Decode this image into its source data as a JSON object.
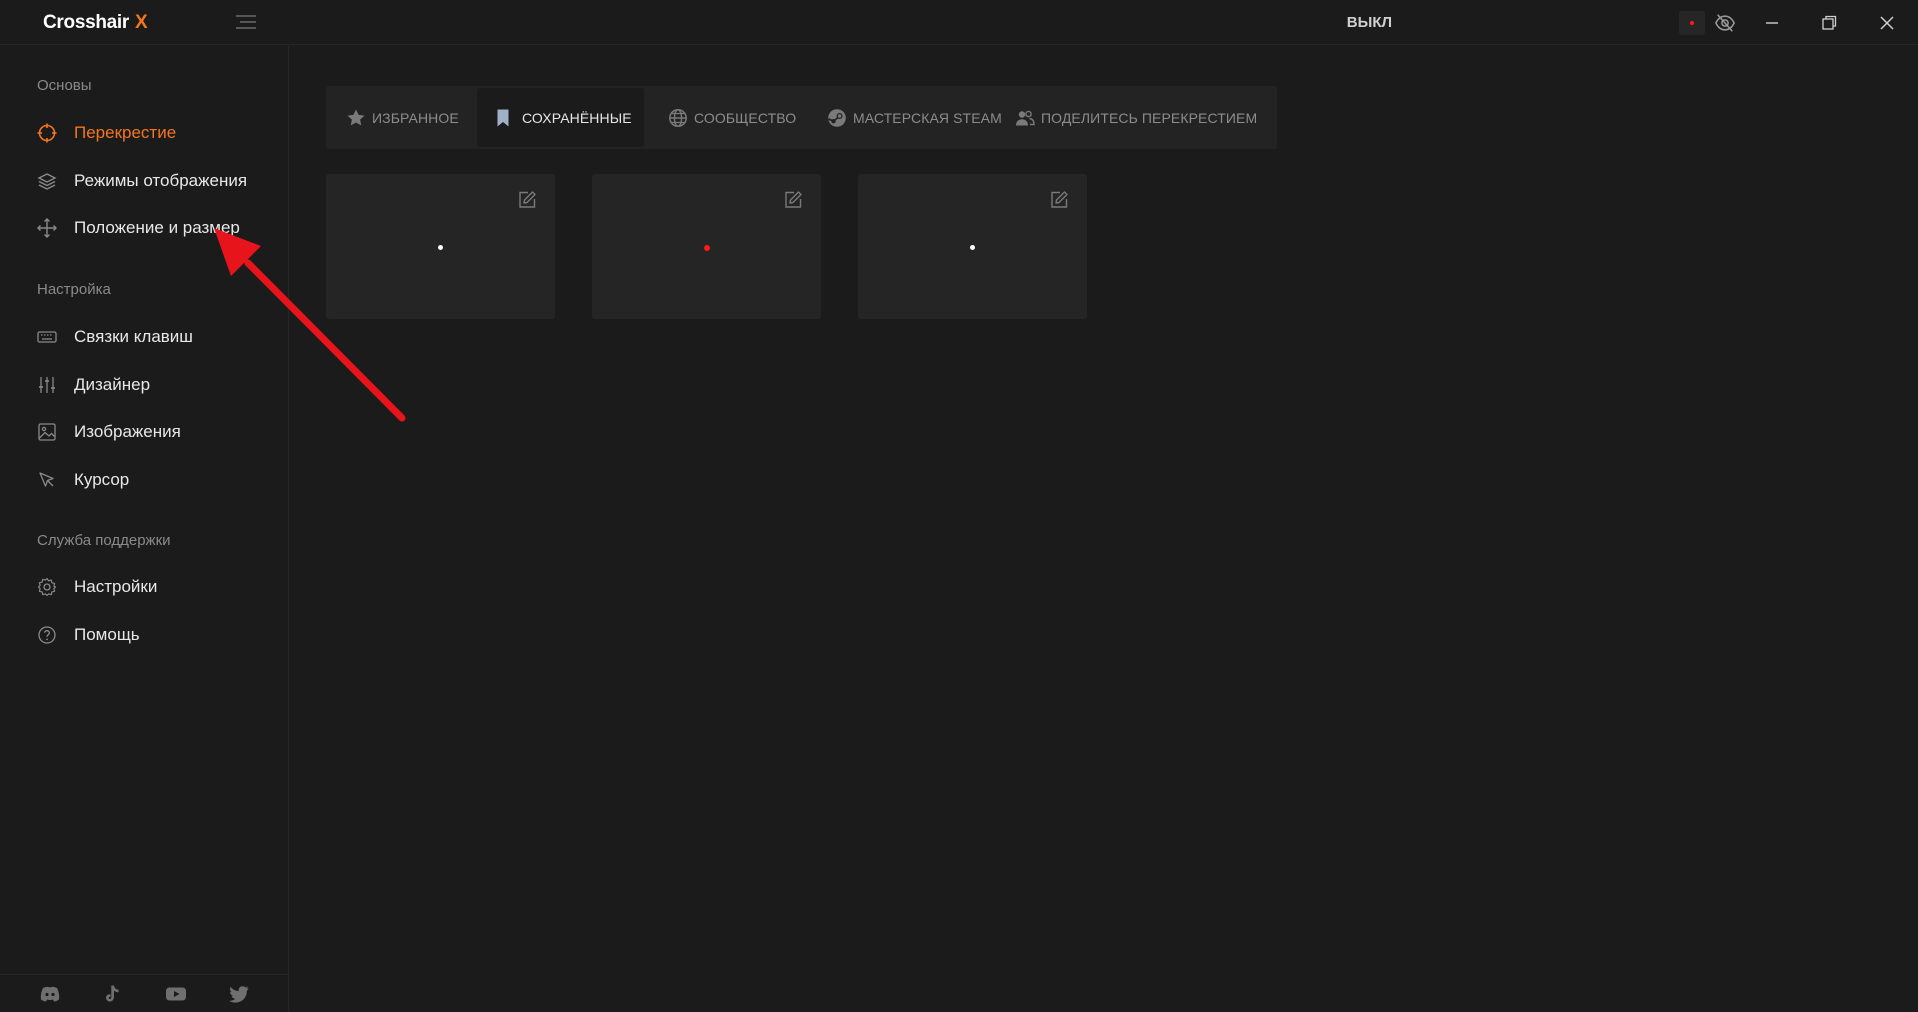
{
  "app": {
    "name": "Crosshair",
    "name_suffix": "X",
    "status_label": "ВЫКЛ"
  },
  "colors": {
    "accent": "#f5751f",
    "background": "#1b1b1b",
    "card": "#252525",
    "dot_red": "#ff1a1a",
    "dot_white": "#ffffff",
    "annotation_arrow": "#e8141c"
  },
  "sidebar": {
    "sections": [
      {
        "title": "Основы",
        "items": [
          {
            "label": "Перекрестие",
            "icon": "crosshair-icon",
            "active": true
          },
          {
            "label": "Режимы отображения",
            "icon": "layers-icon",
            "active": false
          },
          {
            "label": "Положение и размер",
            "icon": "move-icon",
            "active": false
          }
        ]
      },
      {
        "title": "Настройка",
        "items": [
          {
            "label": "Связки клавиш",
            "icon": "keyboard-icon",
            "active": false
          },
          {
            "label": "Дизайнер",
            "icon": "sliders-icon",
            "active": false
          },
          {
            "label": "Изображения",
            "icon": "image-icon",
            "active": false
          },
          {
            "label": "Курсор",
            "icon": "cursor-icon",
            "active": false
          }
        ]
      },
      {
        "title": "Служба поддержки",
        "items": [
          {
            "label": "Настройки",
            "icon": "gear-icon",
            "active": false
          },
          {
            "label": "Помощь",
            "icon": "help-icon",
            "active": false
          }
        ]
      }
    ],
    "footer_icons": [
      "discord-icon",
      "tiktok-icon",
      "youtube-icon",
      "twitter-icon"
    ]
  },
  "tabs": [
    {
      "label": "ИЗБРАННОЕ",
      "icon": "star-icon",
      "active": false
    },
    {
      "label": "СОХРАНЁННЫЕ",
      "icon": "bookmark-icon",
      "active": true
    },
    {
      "label": "СООБЩЕСТВО",
      "icon": "globe-icon",
      "active": false
    },
    {
      "label": "МАСТЕРСКАЯ STEAM",
      "icon": "steam-icon",
      "active": false
    },
    {
      "label": "ПОДЕЛИТЕСЬ ПЕРЕКРЕСТИЕМ",
      "icon": "users-icon",
      "active": false
    }
  ],
  "saved_crosshairs": [
    {
      "dot_color": "#ffffff"
    },
    {
      "dot_color": "#ff1a1a"
    },
    {
      "dot_color": "#ffffff"
    }
  ]
}
